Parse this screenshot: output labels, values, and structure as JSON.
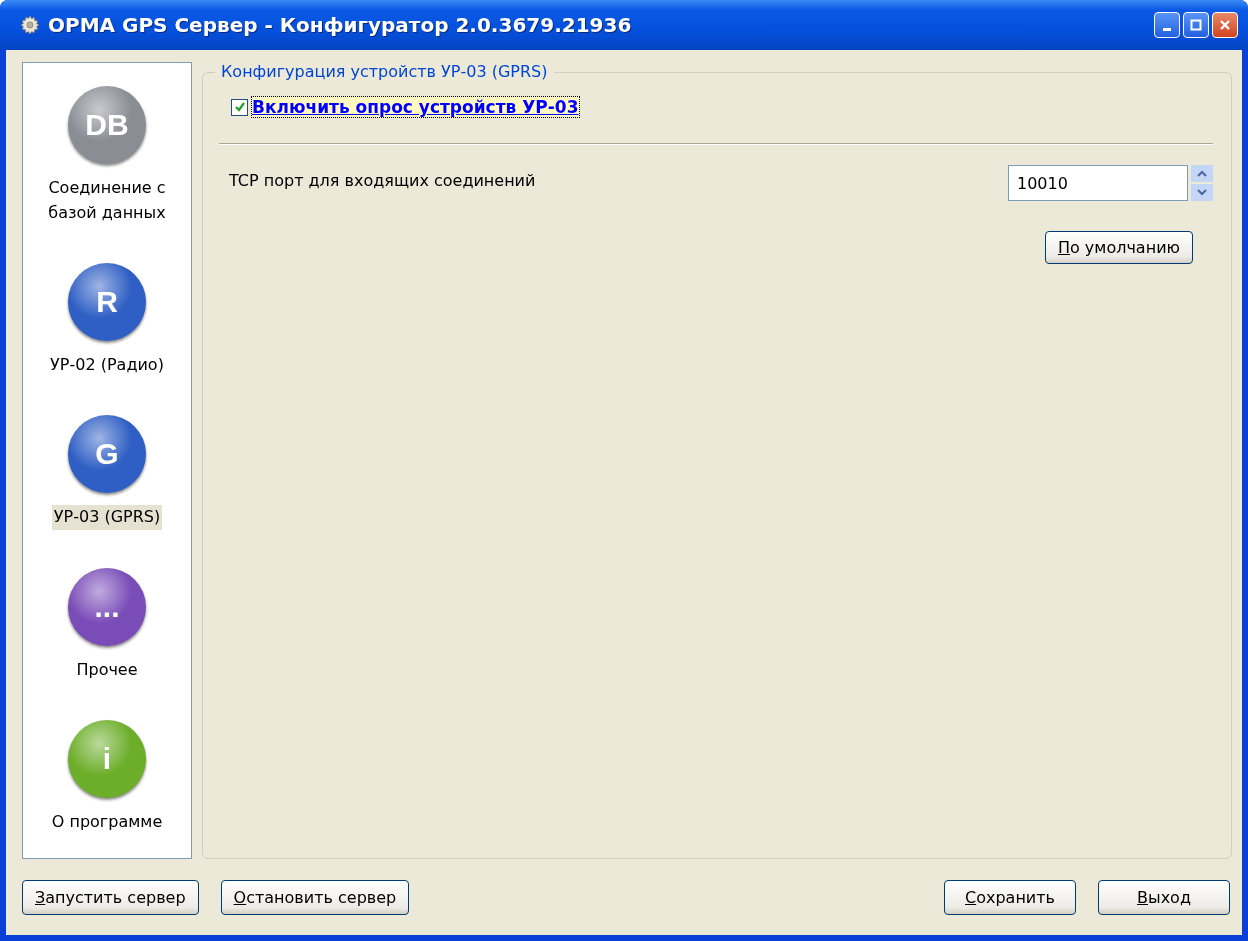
{
  "window": {
    "title": "ОРМА GPS Сервер - Конфигуратор 2.0.3679.21936"
  },
  "sidebar": {
    "items": [
      {
        "icon_text": "DB",
        "label": "Соединение с базой данных",
        "color": "#8a8d94",
        "selected": false
      },
      {
        "icon_text": "R",
        "label": "УР-02 (Радио)",
        "color": "#2f5fc4",
        "selected": false
      },
      {
        "icon_text": "G",
        "label": "УР-03 (GPRS)",
        "color": "#2f5fc4",
        "selected": true
      },
      {
        "icon_text": "...",
        "label": "Прочее",
        "color": "#7a4cb8",
        "selected": false
      },
      {
        "icon_text": "i",
        "label": "О программе",
        "color": "#6cae2a",
        "selected": false
      }
    ]
  },
  "group": {
    "title": "Конфигурация устройств УР-03 (GPRS)",
    "enable_checkbox": {
      "label": "Включить опрос устройств УР-03",
      "checked": true
    },
    "port": {
      "label": "TCP порт для входящих соединений",
      "value": "10010"
    },
    "default_button": "По умолчанию"
  },
  "buttons_left": [
    "Запустить сервер",
    "Остановить сервер"
  ],
  "buttons_right": [
    "Сохранить",
    "Выход"
  ]
}
